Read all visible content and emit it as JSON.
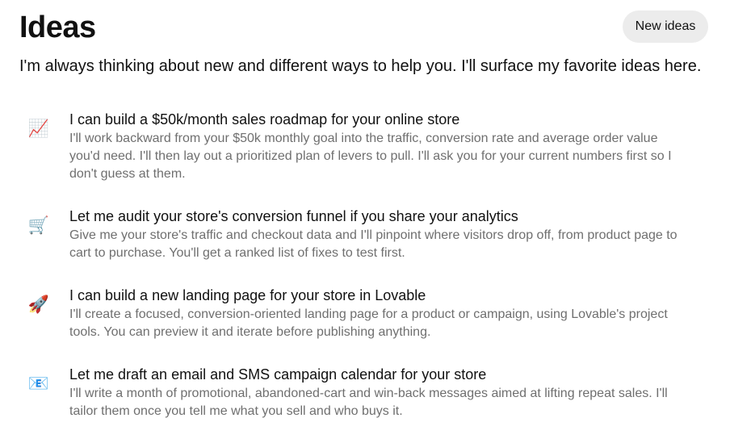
{
  "header": {
    "title": "Ideas",
    "new_ideas_label": "New ideas"
  },
  "intro": "I'm always thinking about new and different ways to help you. I'll surface my favorite ideas here.",
  "ideas": [
    {
      "icon": "chart-increasing-icon",
      "glyph": "📈",
      "title": "I can build a $50k/month sales roadmap for your online store",
      "description": "I'll work backward from your $50k monthly goal into the traffic, conversion rate and average order value you'd need. I'll then lay out a prioritized plan of levers to pull. I'll ask you for your current numbers first so I don't guess at them."
    },
    {
      "icon": "shopping-cart-icon",
      "glyph": "🛒",
      "title": "Let me audit your store's conversion funnel if you share your analytics",
      "description": "Give me your store's traffic and checkout data and I'll pinpoint where visitors drop off, from product page to cart to purchase. You'll get a ranked list of fixes to test first."
    },
    {
      "icon": "rocket-icon",
      "glyph": "🚀",
      "title": "I can build a new landing page for your store in Lovable",
      "description": "I'll create a focused, conversion-oriented landing page for a product or campaign, using Lovable's project tools. You can preview it and iterate before publishing anything."
    },
    {
      "icon": "envelope-icon",
      "glyph": "📧",
      "title": "Let me draft an email and SMS campaign calendar for your store",
      "description": "I'll write a month of promotional, abandoned-cart and win-back messages aimed at lifting repeat sales. I'll tailor them once you tell me what you sell and who buys it."
    }
  ]
}
